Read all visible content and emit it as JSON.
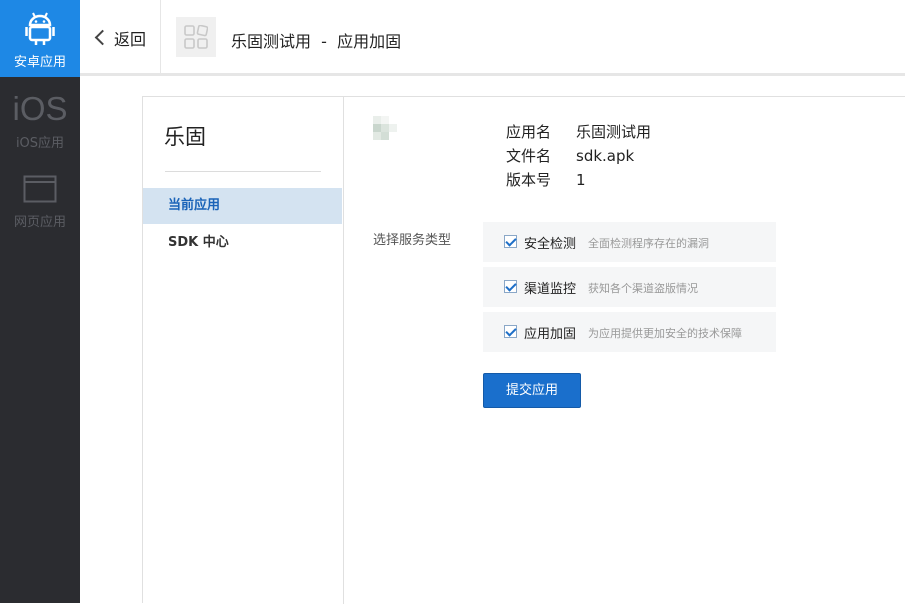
{
  "rail": {
    "items": [
      {
        "label": "安卓应用",
        "icon": "android-icon",
        "active": true
      },
      {
        "label": "iOS应用",
        "glyph": "iOS",
        "icon": "ios-icon",
        "active": false
      },
      {
        "label": "网页应用",
        "icon": "browser-window-icon",
        "active": false
      }
    ]
  },
  "header": {
    "back_label": "返回",
    "title": "乐固测试用  -  应用加固"
  },
  "subnav": {
    "title": "乐固",
    "items": [
      {
        "label": "当前应用",
        "active": true
      },
      {
        "label": "SDK 中心",
        "active": false
      }
    ]
  },
  "app_info": {
    "rows": [
      {
        "key": "应用名",
        "value": "乐固测试用"
      },
      {
        "key": "文件名",
        "value": "sdk.apk"
      },
      {
        "key": "版本号",
        "value": "1"
      }
    ]
  },
  "services": {
    "label": "选择服务类型",
    "options": [
      {
        "name": "安全检测",
        "desc": "全面检测程序存在的漏洞",
        "checked": true
      },
      {
        "name": "渠道监控",
        "desc": "获知各个渠道盗版情况",
        "checked": true
      },
      {
        "name": "应用加固",
        "desc": "为应用提供更加安全的技术保障",
        "checked": true
      }
    ],
    "submit_label": "提交应用"
  },
  "colors": {
    "rail_bg": "#2b2c30",
    "accent": "#1e88e5",
    "button": "#1a6fcc",
    "active_nav_bg": "#d4e3f1"
  }
}
